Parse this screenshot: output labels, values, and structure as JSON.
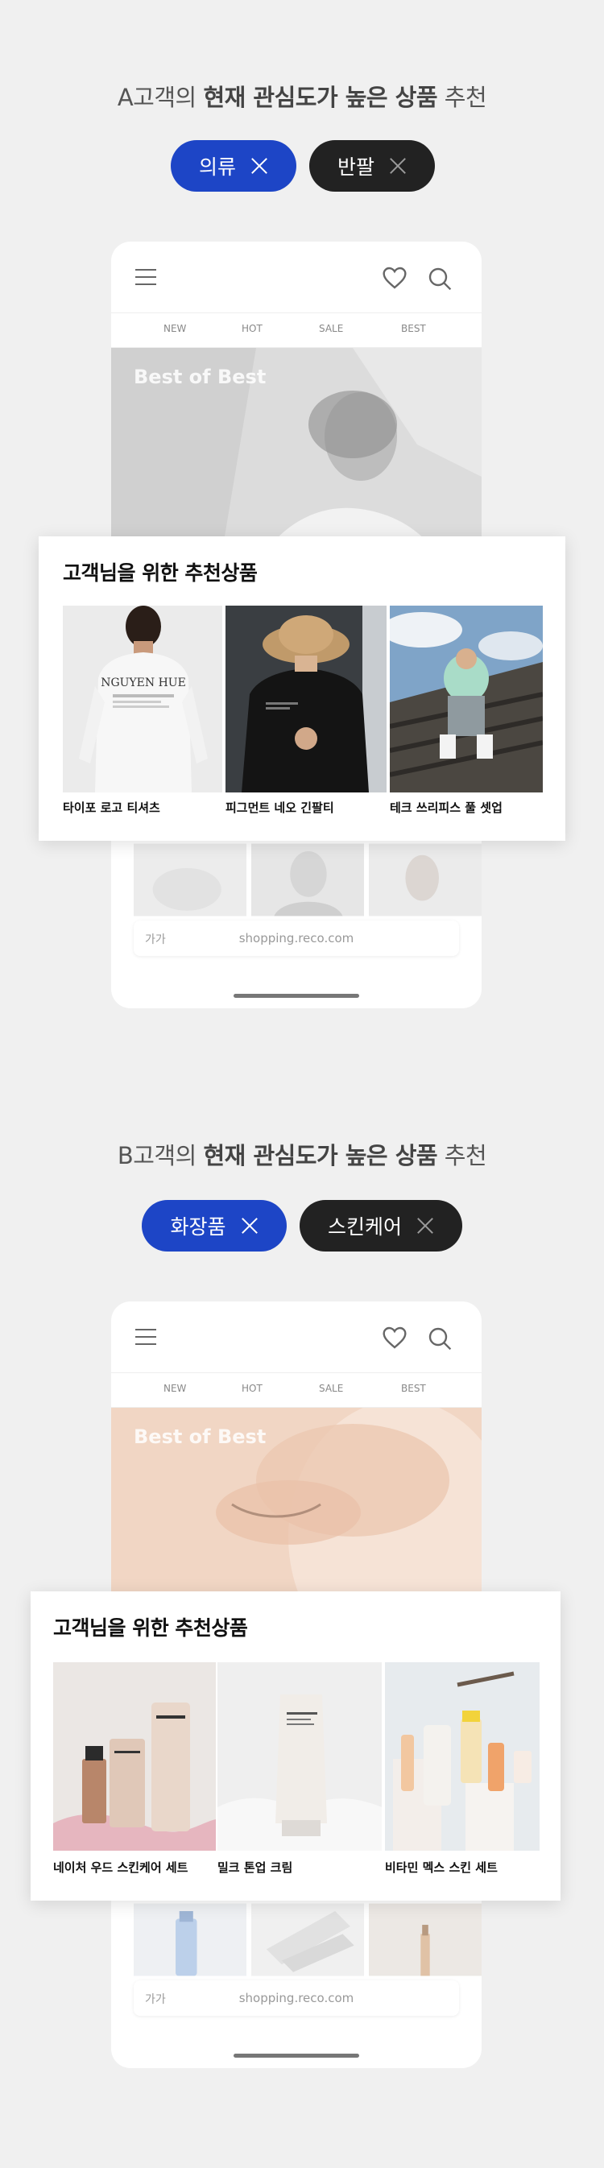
{
  "sections": [
    {
      "headline_prefix": "A고객의 ",
      "headline_bold": "현재 관심도가 높은 상품",
      "headline_suffix": " 추천",
      "chips": [
        {
          "label": "의류",
          "style": "blue"
        },
        {
          "label": "반팔",
          "style": "dark"
        }
      ],
      "phone": {
        "nav": [
          "NEW",
          "HOT",
          "SALE",
          "BEST"
        ],
        "hero_title": "Best of Best",
        "address_aa": "가가",
        "address_url": "shopping.reco.com"
      },
      "rec_title": "고객님을 위한 추천상품",
      "products": [
        {
          "name": "타이포 로고 티셔츠"
        },
        {
          "name": "피그먼트 네오 긴팔티"
        },
        {
          "name": "테크 쓰리피스 풀 셋업"
        }
      ]
    },
    {
      "headline_prefix": "B고객의 ",
      "headline_bold": "현재 관심도가 높은 상품",
      "headline_suffix": " 추천",
      "chips": [
        {
          "label": "화장품",
          "style": "blue"
        },
        {
          "label": "스킨케어",
          "style": "dark"
        }
      ],
      "phone": {
        "nav": [
          "NEW",
          "HOT",
          "SALE",
          "BEST"
        ],
        "hero_title": "Best of Best",
        "address_aa": "가가",
        "address_url": "shopping.reco.com"
      },
      "rec_title": "고객님을 위한 추천상품",
      "products": [
        {
          "name": "네이처 우드 스킨케어 세트"
        },
        {
          "name": "밀크 톤업 크림"
        },
        {
          "name": "비타민 멕스 스킨 세트"
        }
      ]
    }
  ],
  "colors": {
    "background": "#f0f0f0",
    "chip_blue": "#1d45c6",
    "chip_dark": "#222222"
  },
  "icons": [
    "menu-icon",
    "heart-icon",
    "search-icon",
    "close-icon"
  ]
}
